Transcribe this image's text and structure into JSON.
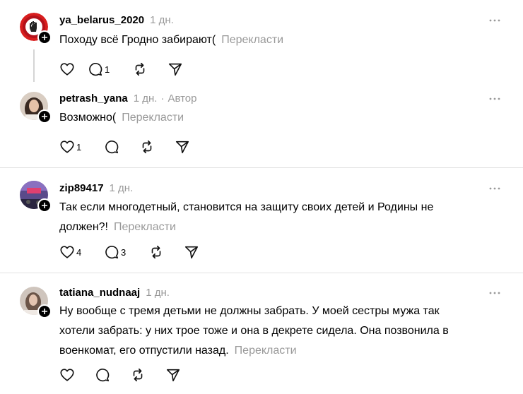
{
  "posts": [
    {
      "username": "ya_belarus_2020",
      "time": "1 дн.",
      "text": "Походу всё Гродно забирают(",
      "translate": "Перекласти",
      "likes": "",
      "replies": "1"
    },
    {
      "username": "petrash_yana",
      "time": "1 дн.",
      "author_sep": "·",
      "author": "Автор",
      "text": "Возможно(",
      "translate": "Перекласти",
      "likes": "1",
      "replies": ""
    },
    {
      "username": "zip89417",
      "time": "1 дн.",
      "text_lines": [
        "Так если многодетный, становится на защиту своих детей и Родины не",
        "должен?!"
      ],
      "translate": "Перекласти",
      "likes": "4",
      "replies": "3"
    },
    {
      "username": "tatiana_nudnaaj",
      "time": "1 дн.",
      "text_lines": [
        "Ну вообще с тремя детьми не должны забрать. У моей сестры мужа так",
        "хотели забрать: у них трое тоже и она в декрете сидела. Она позвонила в",
        "военкомат, его отпустили назад."
      ],
      "translate": "Перекласти",
      "likes": "",
      "replies": ""
    }
  ],
  "icons": {
    "like": "heart-icon",
    "reply": "comment-icon",
    "repost": "repost-icon",
    "share": "send-icon",
    "more": "more-dots-icon",
    "follow": "plus-icon"
  },
  "colors": {
    "muted": "#999999",
    "text": "#000000",
    "divider": "#e2e2e2"
  }
}
